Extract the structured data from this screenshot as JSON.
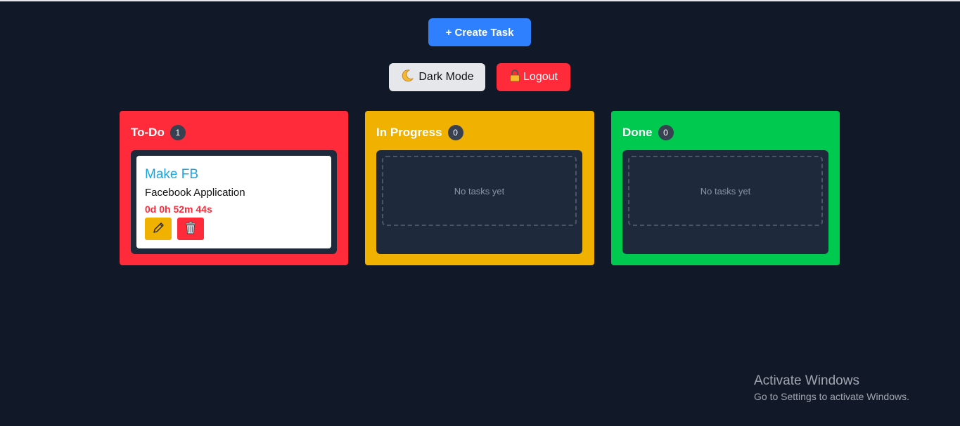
{
  "toolbar": {
    "create_label": "+ Create Task",
    "dark_mode_label": "Dark Mode",
    "dark_mode_icon": "moon-icon",
    "logout_label": "Logout",
    "logout_icon": "lock-icon"
  },
  "columns": [
    {
      "title": "To-Do",
      "count": "1",
      "color": "#ff2a3a",
      "tasks": [
        {
          "title": "Make FB",
          "description": "Facebook Application",
          "timer": "0d 0h 52m 44s",
          "edit_icon": "pencil-icon",
          "delete_icon": "trash-icon"
        }
      ]
    },
    {
      "title": "In Progress",
      "count": "0",
      "color": "#f0b100",
      "empty_text": "No tasks yet"
    },
    {
      "title": "Done",
      "count": "0",
      "color": "#00c950",
      "empty_text": "No tasks yet"
    }
  ],
  "watermark": {
    "title": "Activate Windows",
    "subtitle": "Go to Settings to activate Windows."
  },
  "colors": {
    "background": "#111827",
    "primary": "#2f80ff",
    "task_title": "#1aa6e0"
  }
}
